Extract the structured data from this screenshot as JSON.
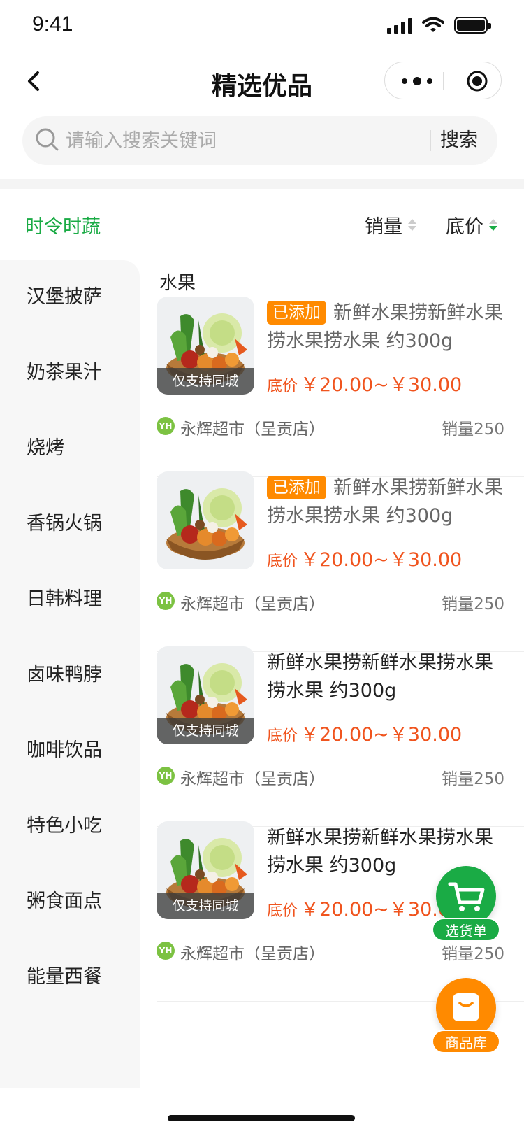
{
  "status_bar": {
    "time": "9:41"
  },
  "header": {
    "title": "精选优品"
  },
  "search": {
    "placeholder": "请输入搜索关键词",
    "button_label": "搜索"
  },
  "categories": {
    "active": "时令时蔬",
    "items": [
      "汉堡披萨",
      "奶茶果汁",
      "烧烤",
      "香锅火锅",
      "日韩料理",
      "卤味鸭脖",
      "咖啡饮品",
      "特色小吃",
      "粥食面点",
      "能量西餐"
    ]
  },
  "sort": {
    "sales_label": "销量",
    "price_label": "底价"
  },
  "section_title": "水果",
  "products": [
    {
      "tag": "已添加",
      "title": "新鲜水果捞新鲜水果捞水果捞水果 约300g",
      "price_label": "底价",
      "price": "￥20.00~￥30.00",
      "badge": "仅支持同城",
      "store": "永辉超市（呈贡店）",
      "store_logo": "YH",
      "sales": "销量250"
    },
    {
      "tag": "已添加",
      "title": "新鲜水果捞新鲜水果捞水果捞水果 约300g",
      "price_label": "底价",
      "price": "￥20.00~￥30.00",
      "badge": "",
      "store": "永辉超市（呈贡店）",
      "store_logo": "YH",
      "sales": "销量250"
    },
    {
      "tag": "",
      "title": "新鲜水果捞新鲜水果捞水果捞水果 约300g",
      "price_label": "底价",
      "price": "￥20.00~￥30.00",
      "badge": "仅支持同城",
      "store": "永辉超市（呈贡店）",
      "store_logo": "YH",
      "sales": "销量250"
    },
    {
      "tag": "",
      "title": "新鲜水果捞新鲜水果捞水果捞水果 约300g",
      "price_label": "底价",
      "price": "￥20.00~￥30.00",
      "badge": "仅支持同城",
      "store": "永辉超市（呈贡店）",
      "store_logo": "YH",
      "sales": "销量250"
    }
  ],
  "floating": {
    "cart_label": "选货单",
    "library_label": "商品库"
  },
  "colors": {
    "accent_green": "#1aab45",
    "accent_orange": "#ff8a00",
    "price_red": "#f0541e"
  },
  "icons": [
    "back-icon",
    "more-dots-icon",
    "record-icon",
    "search-icon",
    "cart-icon",
    "bag-icon"
  ]
}
